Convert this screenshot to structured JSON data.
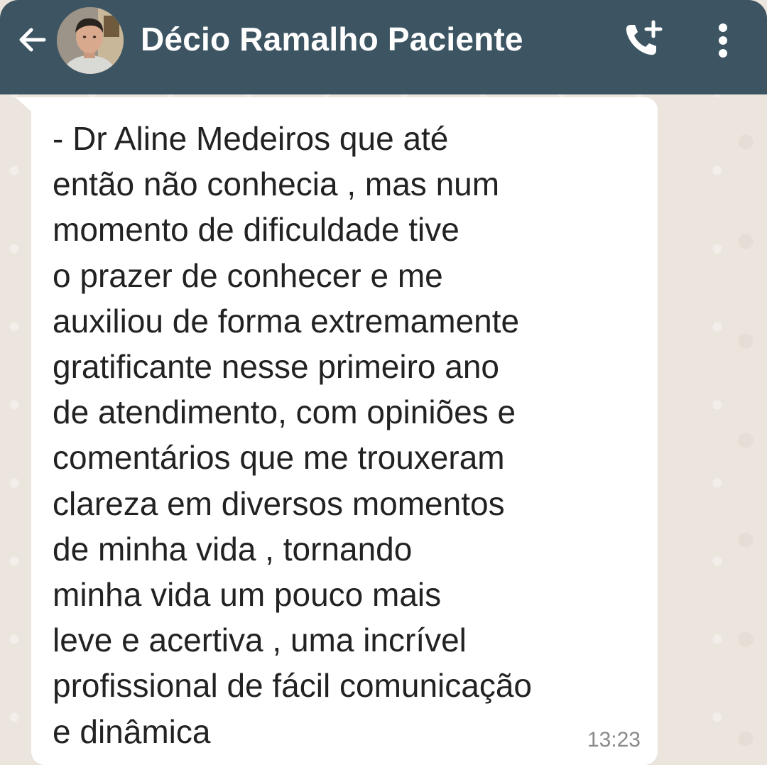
{
  "header": {
    "contact_name": "Décio Ramalho Paciente",
    "back_icon": "arrow-left-icon",
    "avatar_icon": "contact-avatar",
    "call_icon": "add-call-icon",
    "menu_icon": "more-vert-icon"
  },
  "message": {
    "text": "- Dr Aline Medeiros que até\nentão não conhecia , mas num\nmomento de dificuldade tive\no prazer de conhecer e me\nauxiliou de forma extremamente\ngratificante nesse primeiro ano\nde atendimento, com opiniões e\ncomentários que me trouxeram\nclareza em diversos momentos\nde minha vida , tornando\nminha vida um pouco mais\nleve e acertiva , uma incrível\nprofissional de fácil comunicação\ne dinâmica",
    "time": "13:23"
  },
  "colors": {
    "appbar": "#3d5563",
    "wallpaper": "#ece5dd",
    "bubble": "#ffffff",
    "text": "#222222",
    "timestamp": "#8a8a8a"
  }
}
